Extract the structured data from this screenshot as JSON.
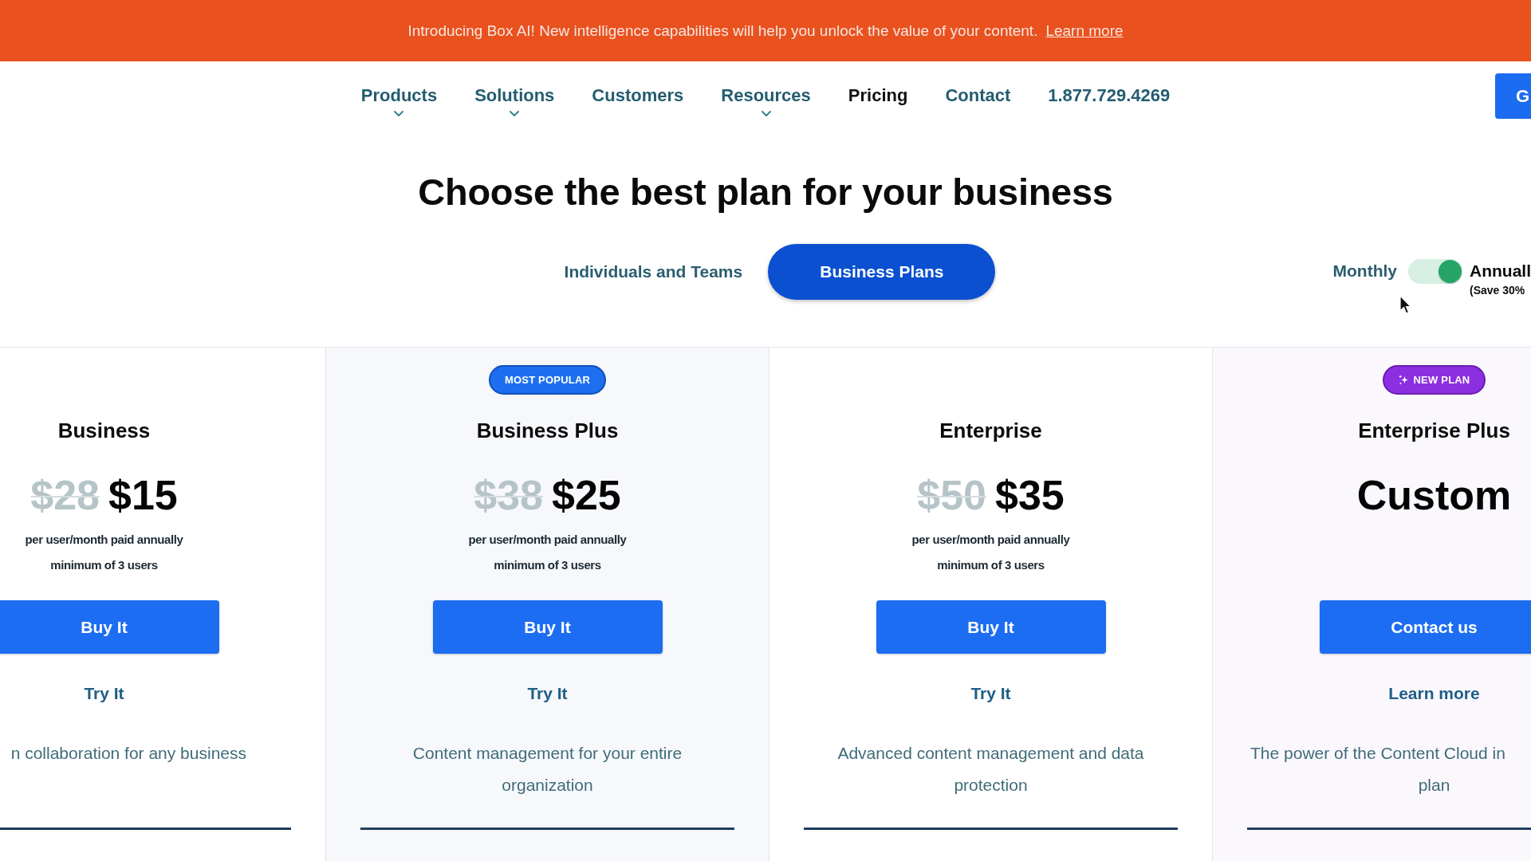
{
  "announcement": {
    "text": "Introducing Box AI! New intelligence capabilities will help you unlock the value of your content.",
    "link": "Learn more"
  },
  "nav": {
    "items": [
      {
        "label": "Products",
        "has_menu": true,
        "selected": false
      },
      {
        "label": "Solutions",
        "has_menu": true,
        "selected": false
      },
      {
        "label": "Customers",
        "has_menu": false,
        "selected": false
      },
      {
        "label": "Resources",
        "has_menu": true,
        "selected": false
      },
      {
        "label": "Pricing",
        "has_menu": false,
        "selected": true
      },
      {
        "label": "Contact",
        "has_menu": false,
        "selected": false
      },
      {
        "label": "1.877.729.4269",
        "has_menu": false,
        "selected": false
      }
    ],
    "button": "G"
  },
  "heading": "Choose the best plan for your business",
  "plan_tabs": [
    {
      "label": "Individuals and Teams",
      "selected": false
    },
    {
      "label": "Business Plans",
      "selected": true
    }
  ],
  "billing": {
    "left_label": "Monthly",
    "on": true,
    "right_label": "Annuall",
    "note": "(Save 30%"
  },
  "plans": [
    {
      "name": "Business",
      "old_price": "$28",
      "price": "$15",
      "notes": [
        "per user/month paid annually",
        "minimum of 3 users"
      ],
      "button": "Buy It",
      "link": "Try It",
      "description": [
        "n collaboration for any business"
      ]
    },
    {
      "badge": {
        "kind": "popular",
        "label": "MOST POPULAR"
      },
      "name": "Business Plus",
      "old_price": "$38",
      "price": "$25",
      "notes": [
        "per user/month paid annually",
        "minimum of 3 users"
      ],
      "button": "Buy It",
      "link": "Try It",
      "description": [
        "Content management for your entire",
        "organization"
      ]
    },
    {
      "name": "Enterprise",
      "old_price": "$50",
      "price": "$35",
      "notes": [
        "per user/month paid annually",
        "minimum of 3 users"
      ],
      "button": "Buy It",
      "link": "Try It",
      "description": [
        "Advanced content management and data",
        "protection"
      ]
    },
    {
      "badge": {
        "kind": "new",
        "label": "NEW PLAN"
      },
      "name": "Enterprise Plus",
      "price": "Custom",
      "button": "Contact us",
      "link": "Learn more",
      "description": [
        "The power of the Content Cloud in",
        "plan"
      ]
    }
  ]
}
